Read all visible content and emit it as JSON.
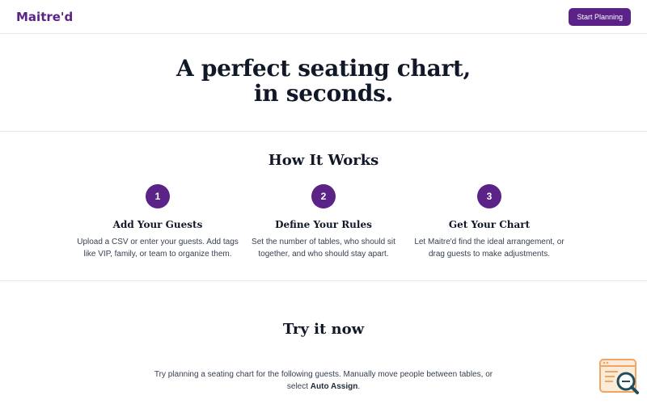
{
  "header": {
    "brand": "Maitre'd",
    "cta_label": "Start Planning"
  },
  "hero": {
    "title_line1": "A perfect seating chart,",
    "title_line2": "in seconds."
  },
  "how_it_works": {
    "title": "How It Works",
    "steps": [
      {
        "number": "1",
        "title": "Add Your Guests",
        "description": "Upload a CSV or enter your guests. Add tags like VIP, family, or team to organize them."
      },
      {
        "number": "2",
        "title": "Define Your Rules",
        "description": "Set the number of tables, who should sit together, and who should stay apart."
      },
      {
        "number": "3",
        "title": "Get Your Chart",
        "description": "Let Maitre'd find the ideal arrangement, or drag guests to make adjustments."
      }
    ]
  },
  "try_it": {
    "title": "Try it now",
    "description": "Try planning a seating chart for the following guests. Manually move people between tables, or select",
    "auto_assign": "Auto Assign",
    "period": "."
  },
  "colors": {
    "brand": "#5b2388",
    "widget_border": "#f0a562",
    "widget_icon": "#1f4f5c"
  },
  "icons": {
    "widget": "search-document-icon"
  }
}
